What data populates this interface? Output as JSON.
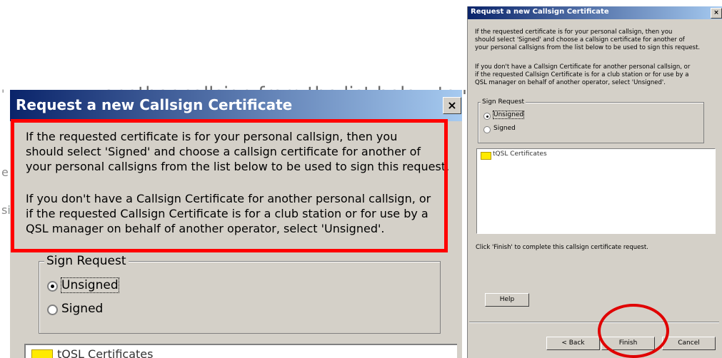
{
  "background_snippet": "...another callsign from the list below to use when signing the request...",
  "left_dialog": {
    "title": "Request a new Callsign Certificate",
    "close_glyph": "×",
    "para1_lines": [
      "If the requested certificate is for your personal callsign, then you",
      "should select 'Signed' and choose a callsign certificate for another of",
      "your personal callsigns from the list below to be used to sign this request."
    ],
    "para2_lines": [
      "If you don't have a Callsign Certificate for another personal callsign, or",
      "if the requested Callsign Certificate is for a club station or for use by a",
      "QSL manager on behalf of another operator, select 'Unsigned'."
    ],
    "group_label": "Sign Request",
    "option_unsigned": "Unsigned",
    "option_signed": "Signed",
    "selected": "Unsigned",
    "tree_root": "tQSL Certificates",
    "highlight_color": "#ff0000",
    "side_glyphs": [
      "'",
      "e",
      "si"
    ]
  },
  "right_dialog": {
    "title": "Request a new Callsign Certificate",
    "close_glyph": "×",
    "para1_lines": [
      "If the requested certificate is for your personal callsign, then you",
      "should select 'Signed' and choose a callsign certificate for another of",
      "your personal callsigns from the list below to be used to sign this request."
    ],
    "para2_lines": [
      "If you don't have a Callsign Certificate for another personal callsign, or",
      "if the requested Callsign Certificate is for a club station or for use by a",
      "QSL manager on behalf of another operator, select 'Unsigned'."
    ],
    "group_label": "Sign Request",
    "option_unsigned": "Unsigned",
    "option_signed": "Signed",
    "selected": "Unsigned",
    "tree_root": "tQSL Certificates",
    "finish_note": "Click 'Finish' to complete this callsign certificate request.",
    "help_label": "Help",
    "back_label": "< Back",
    "finish_label": "Finish",
    "cancel_label": "Cancel",
    "highlight_color": "#e00000"
  },
  "colors": {
    "titlebar_start": "#0a246a",
    "titlebar_end": "#a6caf0",
    "dialog_face": "#d4d0c8",
    "folder": "#ffea00"
  }
}
